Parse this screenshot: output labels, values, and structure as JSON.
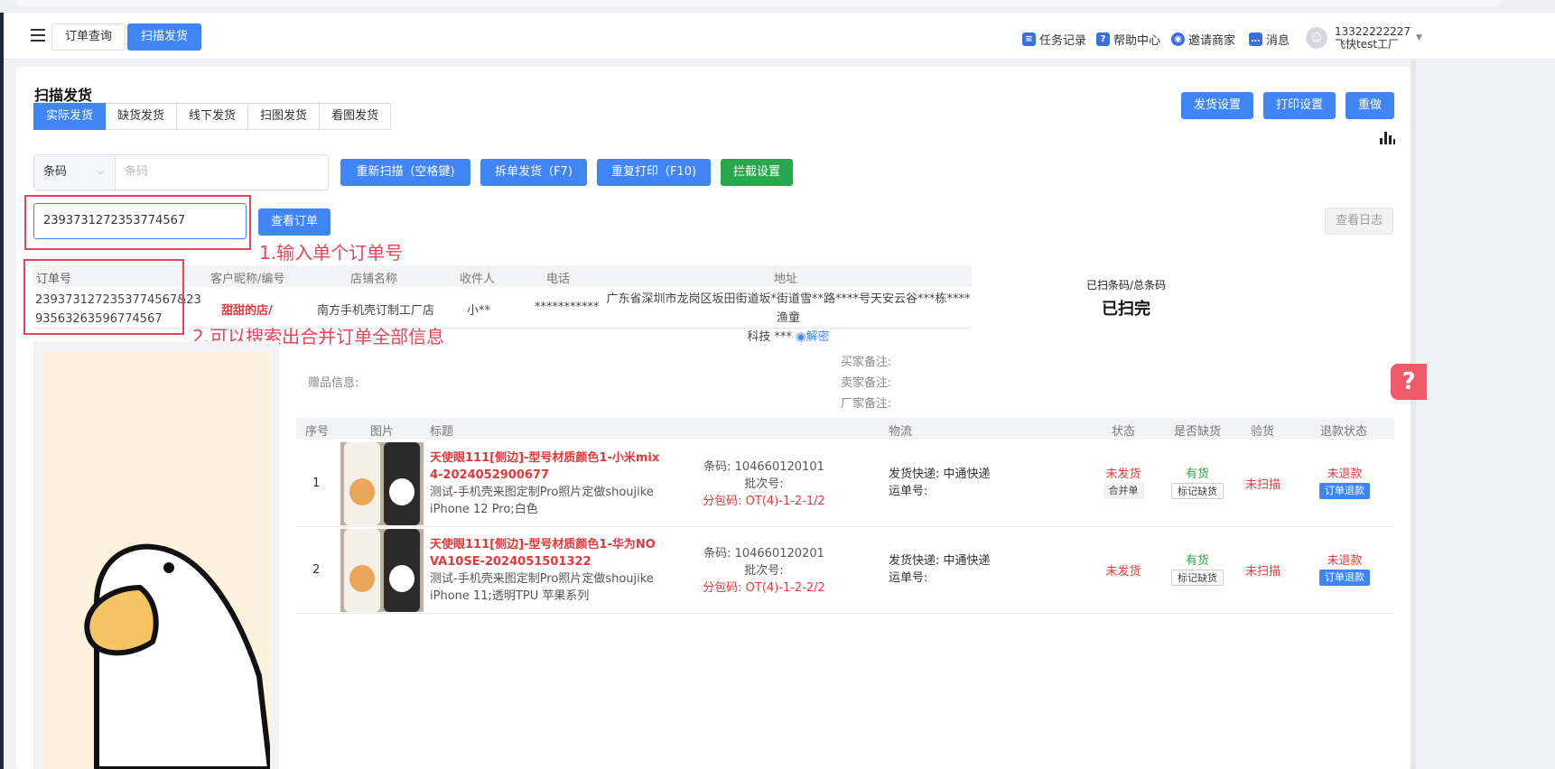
{
  "header": {
    "tabs": [
      {
        "label": "订单查询"
      },
      {
        "label": "扫描发货"
      }
    ],
    "links": [
      "任务记录",
      "帮助中心",
      "邀请商家",
      "消息"
    ],
    "user_phone": "13322222227",
    "user_name": "飞快test工厂"
  },
  "page": {
    "title": "扫描发货",
    "subtabs": [
      "实际发货",
      "缺货发货",
      "线下发货",
      "扫图发货",
      "看图发货"
    ],
    "right_buttons": [
      "发货设置",
      "打印设置",
      "重做"
    ]
  },
  "scan": {
    "type_label": "条码",
    "barcode_placeholder": "条码",
    "buttons": [
      "重新扫描（空格键)",
      "拆单发货（F7)",
      "重复打印（F10)",
      "拦截设置"
    ],
    "order_value": "2393731272353774567",
    "query_button": "查看订单",
    "log_button": "查看日志"
  },
  "annotations": {
    "step1": "1.输入单个订单号",
    "step2": "2.可以搜索出合并订单全部信息"
  },
  "order_table": {
    "headers": [
      "订单号",
      "客户昵称/编号",
      "店铺名称",
      "收件人",
      "电话",
      "地址"
    ],
    "row": {
      "order_no_line1": "2393731272353774567&23",
      "order_no_line2": "93563263596774567",
      "customer": "甜甜的店/",
      "shop": "南方手机壳订制工厂店",
      "receiver": "小**",
      "phone": "***********",
      "address_line1": "广东省深圳市龙岗区坂田街道坂*街道雪**路****号天安云谷***栋****渔童",
      "address_line2": "科技 ***",
      "decrypt": "解密"
    }
  },
  "scan_status": {
    "label": "已扫条码/总条码",
    "value": "已扫完"
  },
  "remarks": {
    "gift": "赠品信息:",
    "buyer": "买家备注:",
    "seller": "卖家备注:",
    "factory": "厂家备注:"
  },
  "items_table": {
    "headers": [
      "序号",
      "图片",
      "标题",
      "物流",
      "状态",
      "是否缺货",
      "验货",
      "退款状态"
    ],
    "rows": [
      {
        "index": "1",
        "title_line1": "天使眼111[侧边]-型号材质颜色1-小米mix",
        "title_line2": "4-2024052900677",
        "desc_line1": "测试-手机壳来图定制Pro照片定做shoujike",
        "desc_line2": "iPhone 12 Pro;白色",
        "barcode": "条码: 104660120101",
        "batch": "批次号:",
        "pack": "分包码: OT(4)-1-2-1/2",
        "express": "发货快递: 中通快递",
        "waybill": "运单号:",
        "status": "未发货",
        "status_tag": "合并单",
        "stock": "有货",
        "stock_tag": "标记缺货",
        "inspect": "未扫描",
        "refund": "未退款",
        "refund_btn": "订单退款"
      },
      {
        "index": "2",
        "title_line1": "天使眼111[侧边]-型号材质颜色1-华为NO",
        "title_line2": "VA10SE-2024051501322",
        "desc_line1": "测试-手机壳来图定制Pro照片定做shoujike",
        "desc_line2": "iPhone 11;透明TPU 苹果系列",
        "barcode": "条码: 104660120201",
        "batch": "批次号:",
        "pack": "分包码: OT(4)-1-2-2/2",
        "express": "发货快递: 中通快递",
        "waybill": "运单号:",
        "status": "未发货",
        "status_tag": "",
        "stock": "有货",
        "stock_tag": "标记缺货",
        "inspect": "未扫描",
        "refund": "未退款",
        "refund_btn": "订单退款"
      }
    ]
  },
  "colors": {
    "primary": "#4085f6",
    "green": "#27a84c",
    "red": "#e4393c",
    "annotation": "#e4455a"
  }
}
